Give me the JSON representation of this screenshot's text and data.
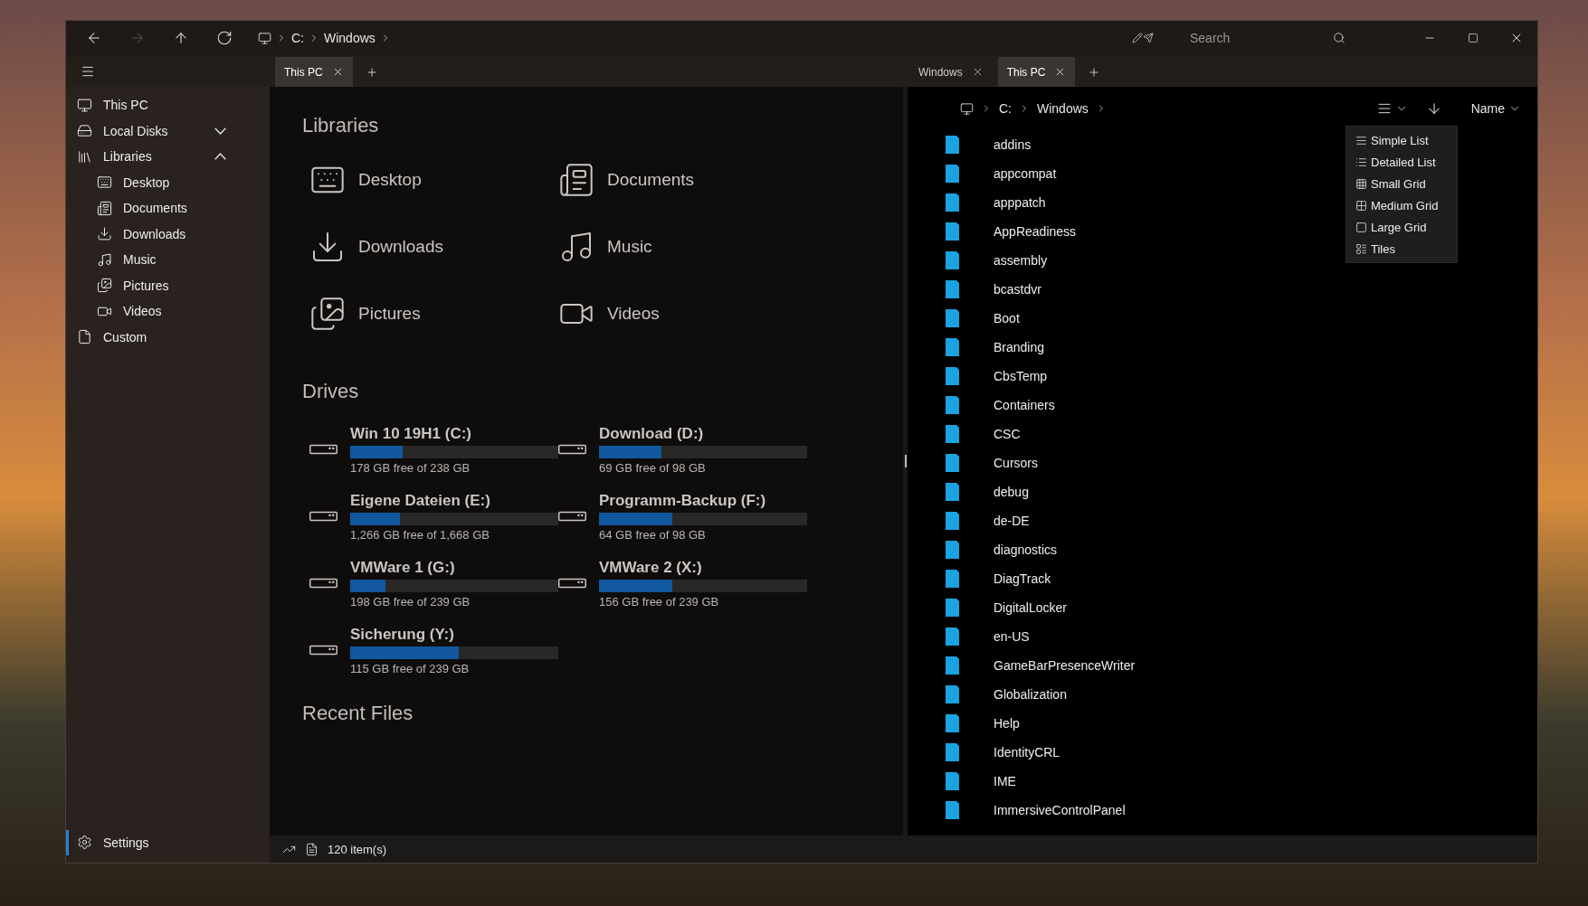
{
  "title_bar": {
    "nav": [
      {
        "kind": "back",
        "disabled": false
      },
      {
        "kind": "forward",
        "disabled": true
      },
      {
        "kind": "up",
        "disabled": false
      },
      {
        "kind": "refresh",
        "disabled": false
      }
    ],
    "breadcrumb": [
      "C:",
      "Windows"
    ],
    "search": {
      "placeholder": "Search"
    }
  },
  "left_tabs": [
    {
      "label": "This PC",
      "selected": true
    }
  ],
  "right_tabs": [
    {
      "label": "Windows",
      "selected": false
    },
    {
      "label": "This PC",
      "selected": true
    }
  ],
  "sidebar": {
    "items": [
      {
        "label": "This PC",
        "kind": "pc",
        "selected": false
      },
      {
        "label": "Local Disks",
        "kind": "disks",
        "selected": false,
        "expanded": false
      },
      {
        "label": "Libraries",
        "kind": "libraries",
        "selected": false,
        "expanded": true,
        "children": [
          {
            "label": "Desktop",
            "kind": "desktop",
            "selected": false
          },
          {
            "label": "Documents",
            "kind": "documents",
            "selected": false
          },
          {
            "label": "Downloads",
            "kind": "downloads",
            "selected": false
          },
          {
            "label": "Music",
            "kind": "music",
            "selected": false
          },
          {
            "label": "Pictures",
            "kind": "pictures",
            "selected": false
          },
          {
            "label": "Videos",
            "kind": "videos",
            "selected": false
          }
        ]
      },
      {
        "label": "Custom",
        "kind": "custom",
        "selected": false
      }
    ],
    "settings": {
      "label": "Settings",
      "selected": true
    }
  },
  "left_pane": {
    "libraries": {
      "title": "Libraries",
      "items": [
        {
          "label": "Desktop",
          "kind": "desktop"
        },
        {
          "label": "Documents",
          "kind": "documents"
        },
        {
          "label": "Downloads",
          "kind": "downloads"
        },
        {
          "label": "Music",
          "kind": "music"
        },
        {
          "label": "Pictures",
          "kind": "pictures"
        },
        {
          "label": "Videos",
          "kind": "videos"
        }
      ]
    },
    "drives": {
      "title": "Drives",
      "items": [
        {
          "name": "Win 10 19H1 (C:)",
          "level": 0.25,
          "reading": "178 GB free of 238 GB"
        },
        {
          "name": "Download (D:)",
          "level": 0.3,
          "reading": "69 GB free of 98 GB"
        },
        {
          "name": "Eigene Dateien (E:)",
          "level": 0.24,
          "reading": "1,266 GB free of 1,668 GB"
        },
        {
          "name": "Programm-Backup (F:)",
          "level": 0.35,
          "reading": "64 GB free of 98 GB"
        },
        {
          "name": "VMWare 1 (G:)",
          "level": 0.17,
          "reading": "198 GB free of 239 GB"
        },
        {
          "name": "VMWare 2 (X:)",
          "level": 0.35,
          "reading": "156 GB free of 239 GB"
        },
        {
          "name": "Sicherung (Y:)",
          "level": 0.52,
          "reading": "115 GB free of 239 GB"
        }
      ]
    },
    "recent": {
      "title": "Recent Files"
    }
  },
  "right_pane": {
    "breadcrumb": [
      "C:",
      "Windows"
    ],
    "sort": {
      "label": "Name"
    },
    "view_menu": {
      "open": true,
      "items": [
        {
          "label": "Simple List",
          "kind": "simple"
        },
        {
          "label": "Detailed List",
          "kind": "detailed"
        },
        {
          "label": "Small Grid",
          "kind": "smallgrid"
        },
        {
          "label": "Medium Grid",
          "kind": "mediumgrid"
        },
        {
          "label": "Large Grid",
          "kind": "largegrid"
        },
        {
          "label": "Tiles",
          "kind": "tiles"
        }
      ]
    },
    "folders": [
      "addins",
      "appcompat",
      "apppatch",
      "AppReadiness",
      "assembly",
      "bcastdvr",
      "Boot",
      "Branding",
      "CbsTemp",
      "Containers",
      "CSC",
      "Cursors",
      "debug",
      "de-DE",
      "diagnostics",
      "DiagTrack",
      "DigitalLocker",
      "en-US",
      "GameBarPresenceWriter",
      "Globalization",
      "Help",
      "IdentityCRL",
      "IME",
      "ImmersiveControlPanel"
    ]
  },
  "status_bar": {
    "count": "120 item(s)"
  }
}
